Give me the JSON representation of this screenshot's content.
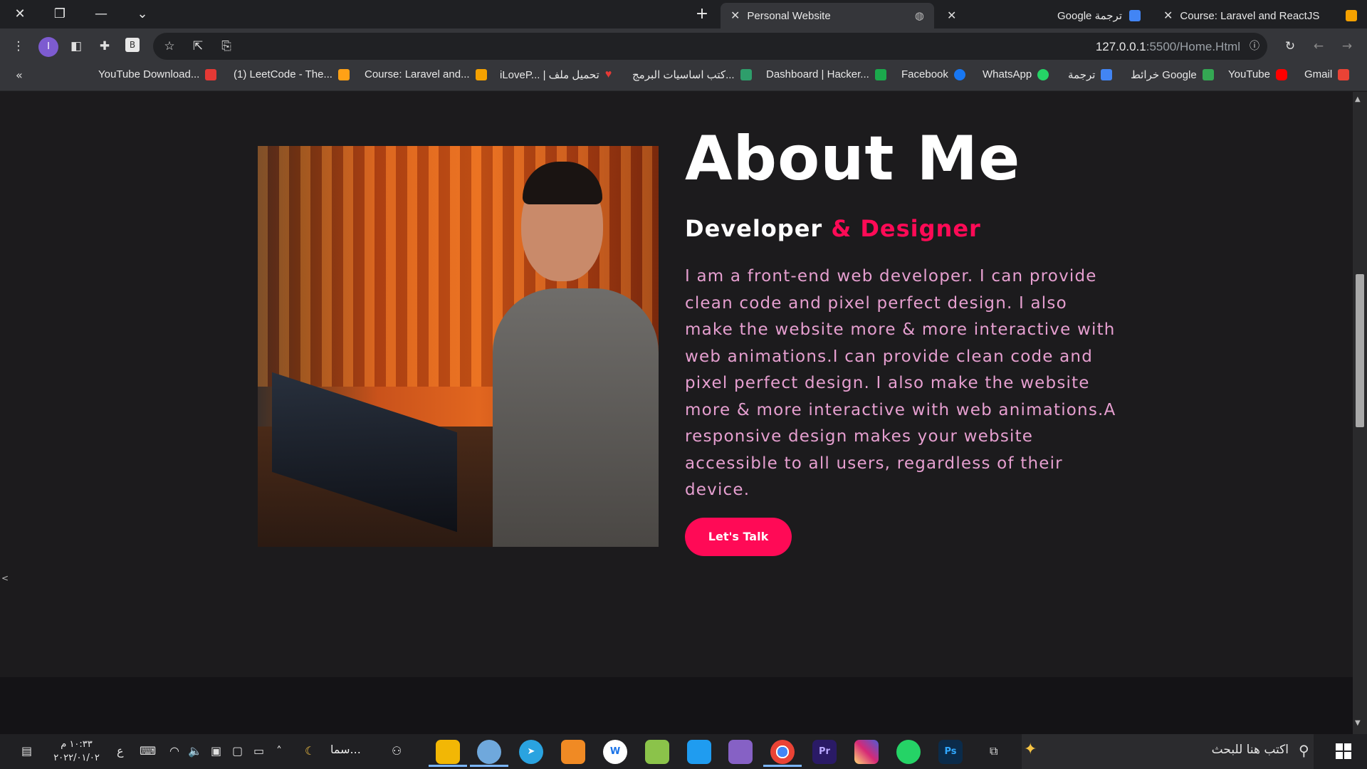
{
  "browser": {
    "tabs": [
      {
        "title": "Personal Website",
        "active": true
      },
      {
        "title": "Google ترجمة",
        "active": false
      },
      {
        "title": "Course: Laravel and ReactJS",
        "active": false
      }
    ],
    "url_host": "127.0.0.1",
    "url_rest": ":5500/Home.Html",
    "profile_initial": "I",
    "bookmarks": [
      {
        "label": "Gmail",
        "icon": "gmail-icon",
        "color": "#ea4335"
      },
      {
        "label": "YouTube",
        "icon": "youtube-icon",
        "color": "#ff0000"
      },
      {
        "label": "خرائط Google",
        "icon": "maps-icon",
        "color": "#34a853"
      },
      {
        "label": "ترجمة",
        "icon": "translate-icon",
        "color": "#4285f4"
      },
      {
        "label": "WhatsApp",
        "icon": "whatsapp-icon",
        "color": "#25d366"
      },
      {
        "label": "Facebook",
        "icon": "facebook-icon",
        "color": "#1877f2"
      },
      {
        "label": "Dashboard | Hacker...",
        "icon": "hackerrank-icon",
        "color": "#1ba94c"
      },
      {
        "label": "كتب اساسيات البرمج...",
        "icon": "book-icon",
        "color": "#2e9e6b"
      },
      {
        "label": "iLoveP... | تحميل ملف",
        "icon": "heart-icon",
        "color": "#e53935"
      },
      {
        "label": "Course: Laravel and...",
        "icon": "course-icon",
        "color": "#f4a100"
      },
      {
        "label": "(1) LeetCode - The...",
        "icon": "leetcode-icon",
        "color": "#ffa116"
      },
      {
        "label": "YouTube Download...",
        "icon": "download-icon",
        "color": "#e53935"
      }
    ]
  },
  "page": {
    "title": "About Me",
    "subtitle_part1": "Developer",
    "subtitle_part2": " & Designer",
    "description": "I am a front-end web developer. I can provide clean code and pixel perfect design. I also make the website more & more interactive with web animations.I can provide clean code and pixel perfect design. I also make the website more & more interactive with web animations.A responsive design makes your website accessible to all users, regardless of their device.",
    "cta_label": "Let's Talk",
    "accent_color": "#ff0a56",
    "text_color": "#e69fd0"
  },
  "taskbar": {
    "time": "١٠:٣٣ م",
    "date": "٢٠٢٢/٠١/٠٢",
    "lang": "ع",
    "weather_label": "سما...",
    "search_placeholder": "اكتب هنا للبحث",
    "apps": [
      {
        "name": "file-explorer",
        "label": "",
        "color": "#f2b705"
      },
      {
        "name": "paint",
        "label": "",
        "color": "#6fa8dc"
      },
      {
        "name": "telegram",
        "label": "",
        "color": "#2aa3e0"
      },
      {
        "name": "windows-terminal",
        "label": "",
        "color": "#f08a24"
      },
      {
        "name": "word-app",
        "label": "",
        "color": "#ffffff"
      },
      {
        "name": "snipping-tool",
        "label": "",
        "color": "#8bc34a"
      },
      {
        "name": "vscode",
        "label": "",
        "color": "#1f9cf0"
      },
      {
        "name": "visual-studio",
        "label": "",
        "color": "#8661c5"
      },
      {
        "name": "chrome",
        "label": "",
        "color": "#ea4335"
      },
      {
        "name": "premiere",
        "label": "Pr",
        "color": "#2a1a66"
      },
      {
        "name": "instagram",
        "label": "",
        "color": "#d6249f"
      },
      {
        "name": "whatsapp",
        "label": "",
        "color": "#25d366"
      },
      {
        "name": "photoshop",
        "label": "Ps",
        "color": "#0b2b4a"
      }
    ]
  }
}
